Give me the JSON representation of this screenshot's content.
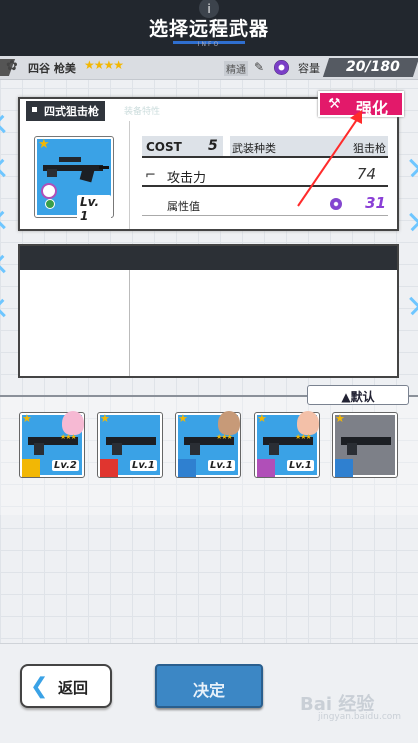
{
  "header": {
    "title": "选择远程武器",
    "subtitle": "INFO",
    "info_icon": "info-icon"
  },
  "status": {
    "character_name": "四谷 枪美",
    "stars": "★★★★",
    "skill_label": "精通",
    "capacity_label": "容量",
    "capacity_value": "20/180"
  },
  "weapon": {
    "name": "四式狙击枪",
    "ghost_text": "装备特性",
    "level": "Lv. 1",
    "cost_label": "COST",
    "cost_value": "5",
    "type_label": "武装种类",
    "type_value": "狙击枪",
    "attack_label": "攻击力",
    "attack_value": "74",
    "attr_label": "属性值",
    "attr_value": "31"
  },
  "enhance_button": {
    "label": "强化",
    "icon": "hammer-icon"
  },
  "sort_button": {
    "label": "▲默认"
  },
  "inventory": [
    {
      "level": "Lv.2",
      "tag_color": "#f2b705",
      "has_face": true,
      "face_color": "#f6b9d3"
    },
    {
      "level": "Lv.1",
      "tag_color": "#e0352f",
      "has_face": false
    },
    {
      "level": "Lv.1",
      "tag_color": "#2f80d0",
      "has_face": true,
      "face_color": "#c79a78"
    },
    {
      "level": "Lv.1",
      "tag_color": "#b04fb8",
      "has_face": true,
      "face_color": "#f3c0a8"
    },
    {
      "level": "",
      "tag_color": "#2f80d0",
      "has_face": false
    }
  ],
  "footer": {
    "back_label": "返回",
    "confirm_label": "决定"
  },
  "watermark": {
    "main": "Bai 经验",
    "sub": "jingyan.baidu.com"
  },
  "colors": {
    "accent": "#3aa2e6",
    "enhance": "#e3196a",
    "attr": "#8a3fd6",
    "header_bg": "#22272e"
  }
}
